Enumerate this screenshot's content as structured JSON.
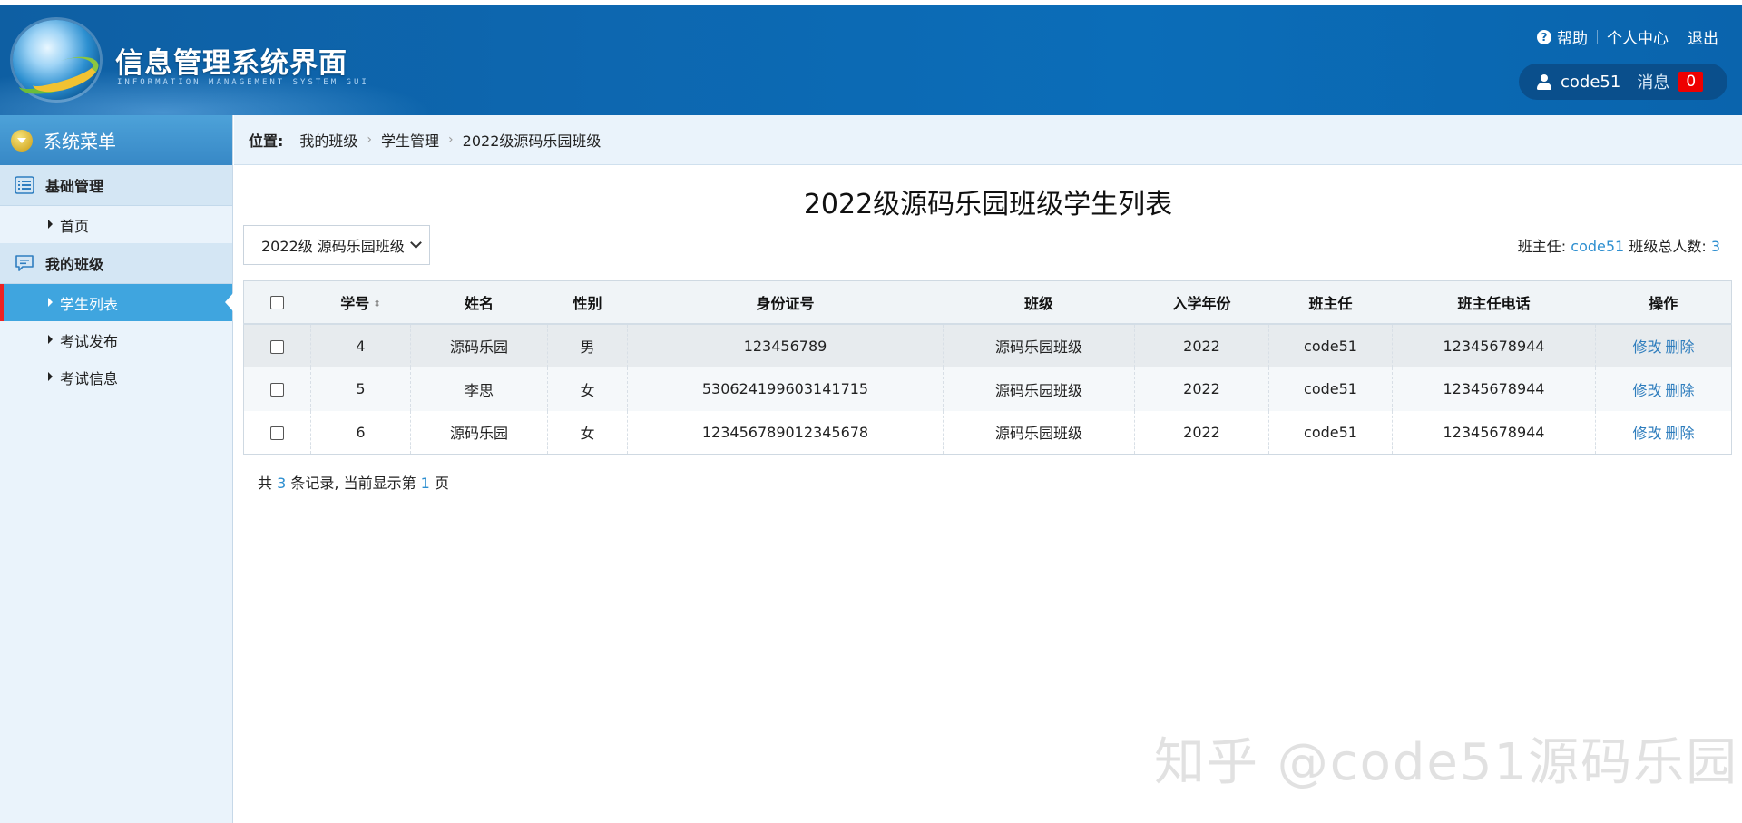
{
  "header": {
    "app_title": "信息管理系统界面",
    "app_subtitle": "INFORMATION MANAGEMENT SYSTEM GUI",
    "help_label": "帮助",
    "profile_label": "个人中心",
    "logout_label": "退出",
    "username": "code51",
    "message_label": "消息",
    "message_count": "0"
  },
  "sidebar": {
    "title": "系统菜单",
    "groups": [
      {
        "label": "基础管理",
        "icon": "list-icon",
        "items": [
          {
            "label": "首页"
          }
        ]
      },
      {
        "label": "我的班级",
        "icon": "chat-icon",
        "items": [
          {
            "label": "学生列表",
            "active": true
          },
          {
            "label": "考试发布"
          },
          {
            "label": "考试信息"
          }
        ]
      }
    ]
  },
  "breadcrumb": {
    "prefix": "位置:",
    "items": [
      "我的班级",
      "学生管理",
      "2022级源码乐园班级"
    ]
  },
  "main": {
    "title": "2022级源码乐园班级学生列表",
    "class_select": "2022级 源码乐园班级",
    "head_teacher_label": "班主任:",
    "head_teacher": "code51",
    "total_label": "班级总人数:",
    "total": "3"
  },
  "table": {
    "columns": [
      "学号",
      "姓名",
      "性别",
      "身份证号",
      "班级",
      "入学年份",
      "班主任",
      "班主任电话",
      "操作"
    ],
    "rows": [
      {
        "id": "4",
        "name": "源码乐园",
        "gender": "男",
        "id_card": "123456789",
        "class": "源码乐园班级",
        "year": "2022",
        "teacher": "code51",
        "phone": "12345678944"
      },
      {
        "id": "5",
        "name": "李思",
        "gender": "女",
        "id_card": "530624199603141715",
        "class": "源码乐园班级",
        "year": "2022",
        "teacher": "code51",
        "phone": "12345678944"
      },
      {
        "id": "6",
        "name": "源码乐园",
        "gender": "女",
        "id_card": "123456789012345678",
        "class": "源码乐园班级",
        "year": "2022",
        "teacher": "code51",
        "phone": "12345678944"
      }
    ],
    "edit_label": "修改",
    "delete_label": "删除"
  },
  "pager": {
    "prefix": "共",
    "total": "3",
    "mid": "条记录,  当前显示第",
    "page": "1",
    "suffix": "页"
  },
  "watermark": "知乎 @code51源码乐园",
  "colors": {
    "header_bg": "#0d67b0",
    "accent": "#3fa5df",
    "link": "#2e7dbd",
    "badge": "#e00000"
  }
}
